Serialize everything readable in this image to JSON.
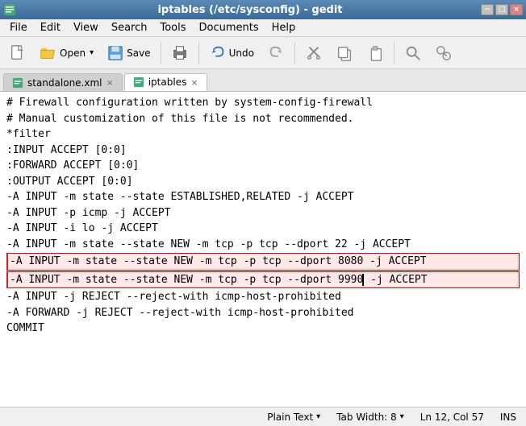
{
  "titleBar": {
    "title": "iptables (/etc/sysconfig) - gedit",
    "minimize": "−",
    "maximize": "□",
    "close": "×"
  },
  "menuBar": {
    "items": [
      "File",
      "Edit",
      "View",
      "Search",
      "Tools",
      "Documents",
      "Help"
    ]
  },
  "toolbar": {
    "newLabel": "🗋",
    "openLabel": "Open",
    "openArrow": "▾",
    "saveLabel": "Save",
    "printLabel": "🖨",
    "undoLabel": "Undo",
    "redoLabel": "↷",
    "cutLabel": "✂",
    "copyLabel": "⧉",
    "pasteLabel": "📋",
    "findLabel": "🔍",
    "replaceLabel": "🔎"
  },
  "tabs": [
    {
      "label": "standalone.xml",
      "active": false
    },
    {
      "label": "iptables",
      "active": true
    }
  ],
  "editor": {
    "lines": [
      {
        "text": "# Firewall configuration written by system-config-firewall",
        "highlight": false
      },
      {
        "text": "# Manual customization of this file is not recommended.",
        "highlight": false
      },
      {
        "text": "*filter",
        "highlight": false
      },
      {
        "text": ":INPUT ACCEPT [0:0]",
        "highlight": false
      },
      {
        "text": ":FORWARD ACCEPT [0:0]",
        "highlight": false
      },
      {
        "text": ":OUTPUT ACCEPT [0:0]",
        "highlight": false
      },
      {
        "text": "-A INPUT -m state --state ESTABLISHED,RELATED -j ACCEPT",
        "highlight": false
      },
      {
        "text": "-A INPUT -p icmp -j ACCEPT",
        "highlight": false
      },
      {
        "text": "-A INPUT -i lo -j ACCEPT",
        "highlight": false
      },
      {
        "text": "-A INPUT -m state --state NEW -m tcp -p tcp --dport 22 -j ACCEPT",
        "highlight": false
      },
      {
        "text": "-A INPUT -m state --state NEW -m tcp -p tcp --dport 8080 -j ACCEPT",
        "highlight": true
      },
      {
        "text": "-A INPUT -m state --state NEW -m tcp -p tcp --dport 9990 -j ACCEPT",
        "highlight": true
      },
      {
        "text": "-A INPUT -j REJECT --reject-with icmp-host-prohibited",
        "highlight": false
      },
      {
        "text": "-A FORWARD -j REJECT --reject-with icmp-host-prohibited",
        "highlight": false
      },
      {
        "text": "COMMIT",
        "highlight": false
      }
    ]
  },
  "statusBar": {
    "textType": "Plain Text",
    "tabWidth": "Tab Width: 8",
    "cursor": "Ln 12, Col 57",
    "mode": "INS",
    "arrow": "▾"
  }
}
